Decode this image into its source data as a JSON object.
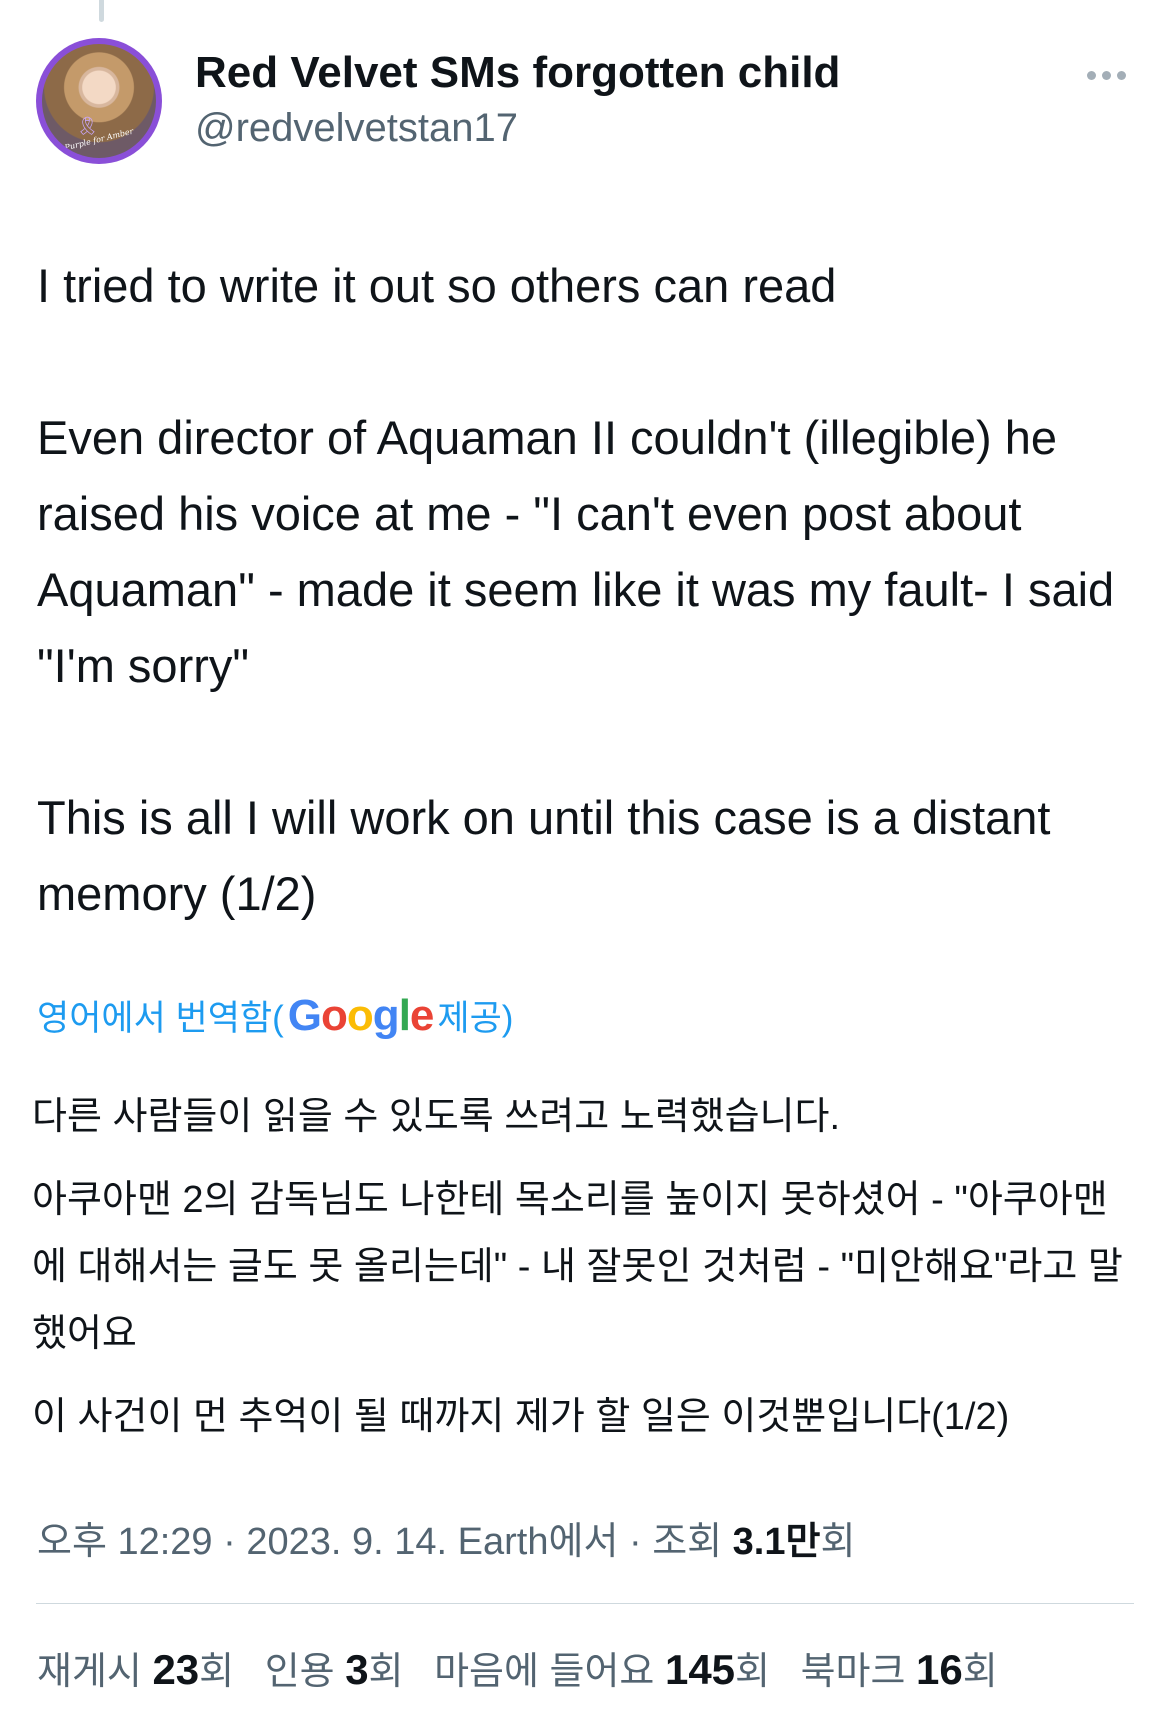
{
  "author": {
    "display_name": "Red Velvet SMs forgotten child",
    "handle": "@redvelvetstan17",
    "avatar_caption": "Purple for Amber"
  },
  "tweet": {
    "line1": "I tried to write it out so others can read",
    "para2": "Even director of Aquaman II couldn't (illegible) he raised his voice at me - \"I can't even post about Aquaman\" - made it seem like it was my fault- I said \"I'm sorry\"",
    "para3": "This is all I will work on until this case is a distant memory (1/2)"
  },
  "translation": {
    "label_prefix": "영어에서 번역함(",
    "label_suffix": " 제공)",
    "google_letters": [
      "G",
      "o",
      "o",
      "g",
      "l",
      "e"
    ],
    "p1": "다른 사람들이 읽을 수 있도록 쓰려고 노력했습니다.",
    "p2": "아쿠아맨 2의 감독님도 나한테 목소리를 높이지 못하셨어 - \"아쿠아맨에 대해서는 글도 못 올리는데\" - 내 잘못인 것처럼 - \"미안해요\"라고 말했어요",
    "p3": "이 사건이 먼 추억이 될 때까지 제가 할 일은 이것뿐입니다(1/2)"
  },
  "meta": {
    "time": "오후 12:29",
    "date": "2023. 9. 14.",
    "source": "Earth에서",
    "views_label": "조회",
    "views_count": "3.1만",
    "views_suffix": "회"
  },
  "stats": [
    {
      "label": "재게시",
      "count": "23",
      "unit": "회"
    },
    {
      "label": "인용",
      "count": "3",
      "unit": "회"
    },
    {
      "label": "마음에 들어요",
      "count": "145",
      "unit": "회"
    },
    {
      "label": "북마크",
      "count": "16",
      "unit": "회"
    }
  ],
  "colors": {
    "link": "#1d9bf0",
    "secondary_text": "#536471",
    "primary_text": "#0f1419",
    "avatar_ring": "#8a4fd8"
  },
  "icons": {
    "more": "more-horizontal-icon"
  }
}
